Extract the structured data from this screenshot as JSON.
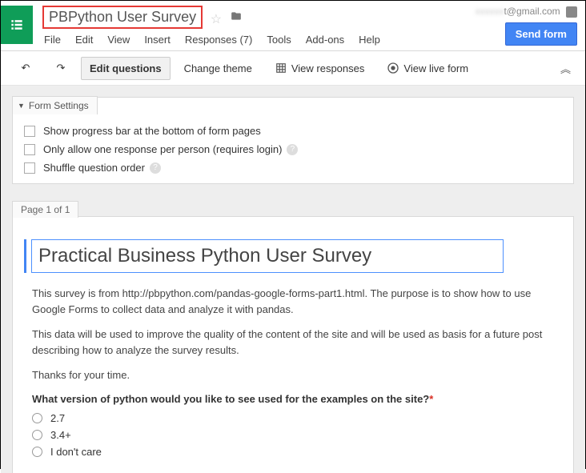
{
  "header": {
    "doc_title": "PBPython User Survey",
    "user_email": "t@gmail.com",
    "send_button": "Send form"
  },
  "menu": {
    "items": [
      "File",
      "Edit",
      "View",
      "Insert",
      "Responses (7)",
      "Tools",
      "Add-ons",
      "Help"
    ]
  },
  "toolbar": {
    "edit_questions": "Edit questions",
    "change_theme": "Change theme",
    "view_responses": "View responses",
    "view_live": "View live form"
  },
  "form_settings": {
    "tab": "Form Settings",
    "options": [
      "Show progress bar at the bottom of form pages",
      "Only allow one response per person (requires login)",
      "Shuffle question order"
    ]
  },
  "form": {
    "page_label": "Page 1 of 1",
    "title": "Practical Business Python User Survey",
    "desc_p1": "This survey is from http://pbpython.com/pandas-google-forms-part1.html. The purpose is to show how to use Google Forms to collect data and analyze it with pandas.",
    "desc_p2": "This data will be used to improve the quality of the content of the site and will be used as basis for a future post describing how to analyze the survey results.",
    "desc_p3": "Thanks for your time.",
    "q1": {
      "label": "What version of python would you like to see used for the examples on the site?",
      "opts": [
        "2.7",
        "3.4+",
        "I don't care"
      ]
    }
  }
}
